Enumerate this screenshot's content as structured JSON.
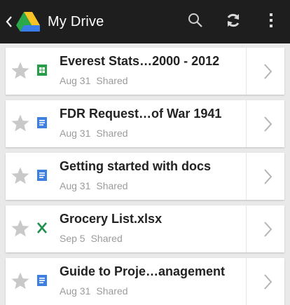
{
  "appbar": {
    "title": "My Drive",
    "icons": [
      "back-arrow-icon",
      "drive-logo-icon",
      "search-icon",
      "refresh-icon",
      "overflow-menu-icon"
    ]
  },
  "files": [
    {
      "name": "Everest Stats…2000 - 2012",
      "date": "Aug 31",
      "status": "Shared",
      "type": "spreadsheet"
    },
    {
      "name": "FDR Request…of War 1941",
      "date": "Aug 31",
      "status": "Shared",
      "type": "document"
    },
    {
      "name": "Getting started with docs",
      "date": "Aug 31",
      "status": "Shared",
      "type": "document"
    },
    {
      "name": "Grocery List.xlsx",
      "date": "Sep 5",
      "status": "Shared",
      "type": "excel"
    },
    {
      "name": "Guide to Proje…anagement",
      "date": "Aug 31",
      "status": "Shared",
      "type": "document"
    }
  ],
  "colors": {
    "appbar": "#1e1e1e",
    "spreadsheet": "#2a9d4a",
    "document": "#3f7fe0",
    "excel": "#1f8f4c",
    "star": "#c9c9c9"
  }
}
